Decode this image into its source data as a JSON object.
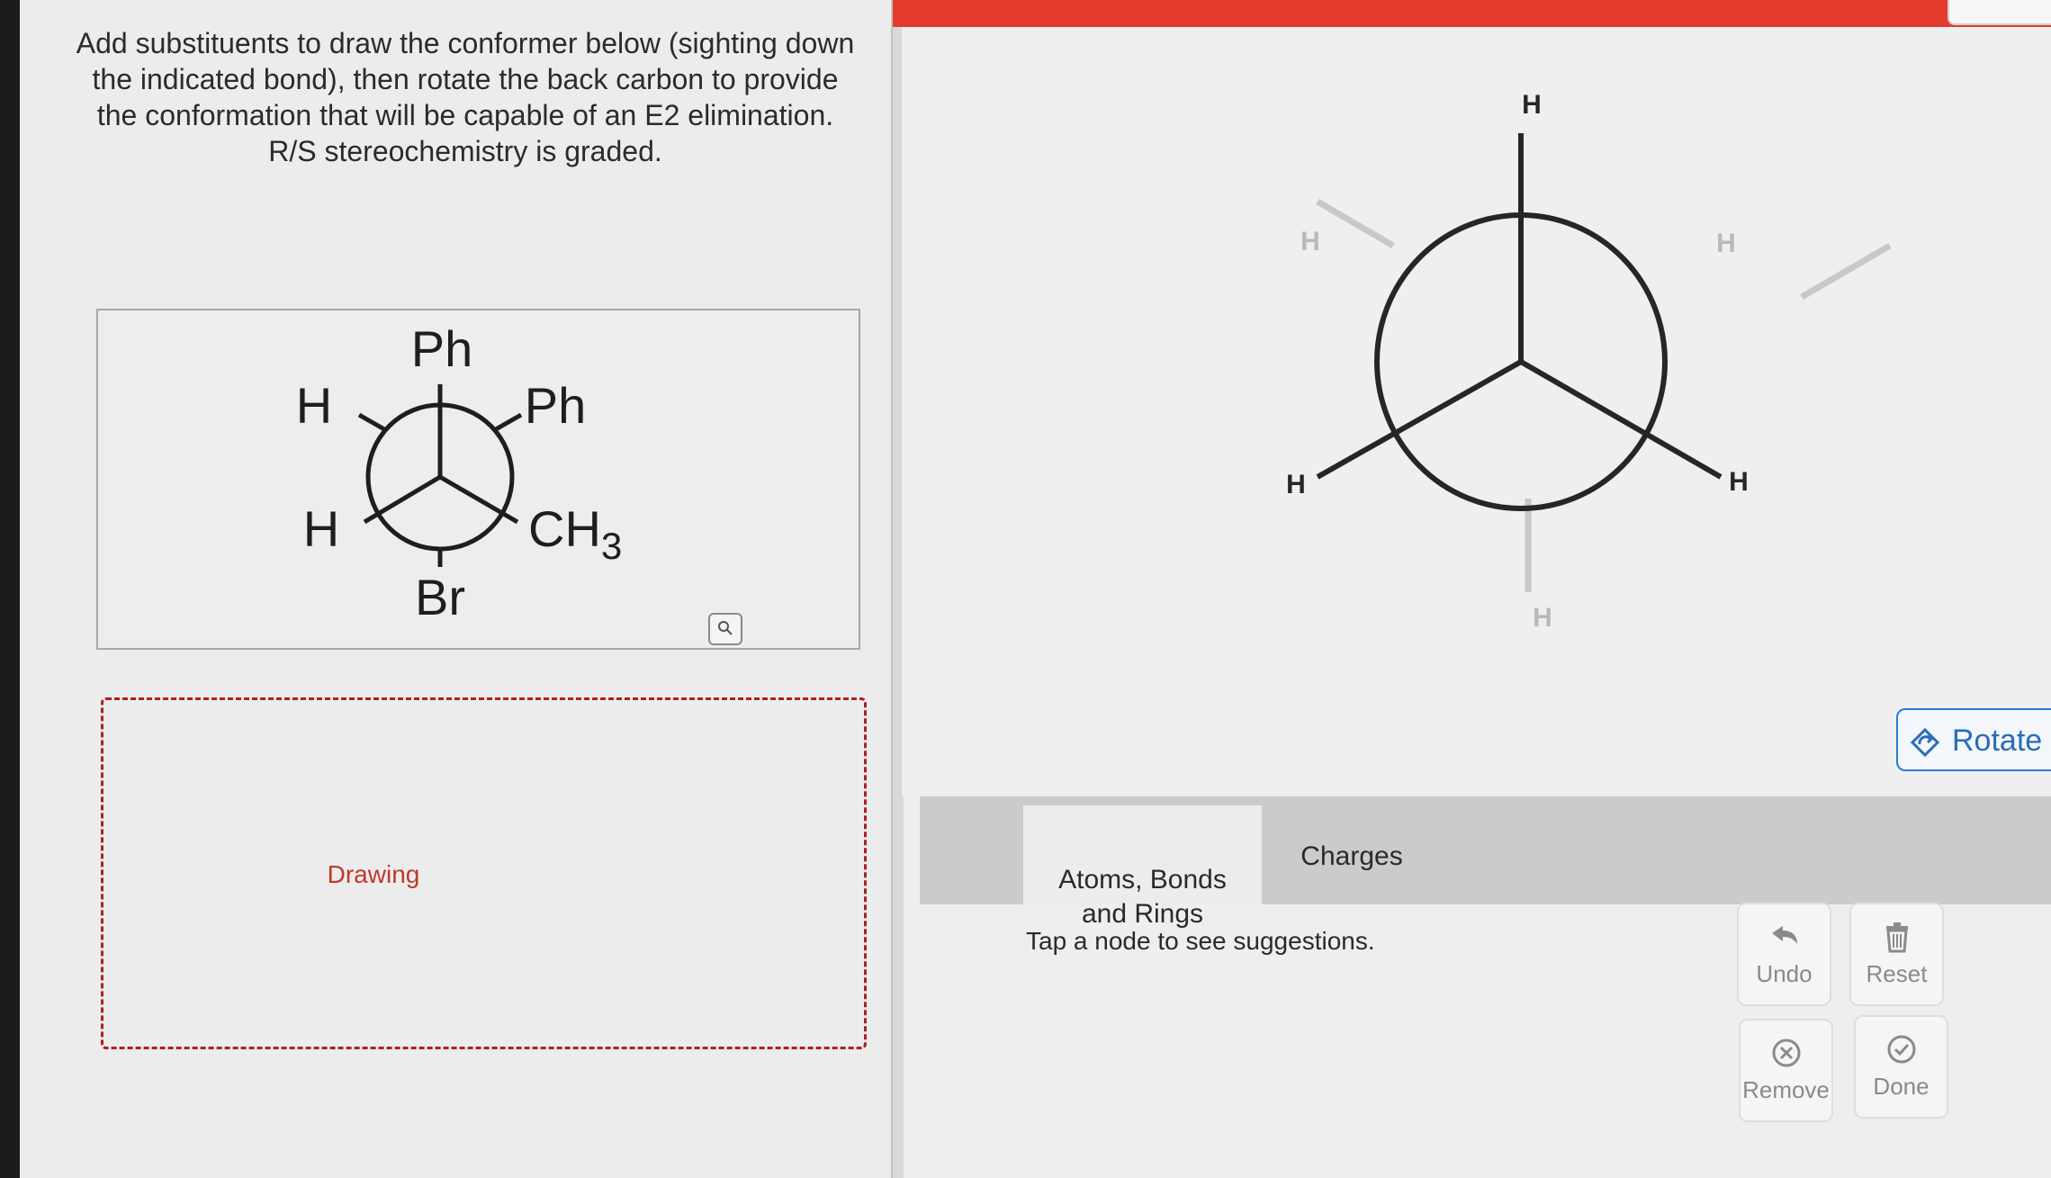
{
  "instructions": "Add substituents to draw the conformer below (sighting down the indicated bond), then rotate the back carbon to provide the conformation that will be capable of an E2 elimination. R/S stereochemistry is graded.",
  "reference_newman": {
    "front_top": "Ph",
    "front_left": "H",
    "front_right": "CH",
    "front_right_subscript": "3",
    "back_top_right": "Ph",
    "back_left": "H",
    "back_bottom": "Br"
  },
  "zoom_icon": "magnifier-icon",
  "drawing_label": "Drawing",
  "canvas_newman": {
    "front_top": "H",
    "front_left": "H",
    "front_right": "H",
    "back_upper_left": "H",
    "back_upper_right": "H",
    "back_bottom": "H"
  },
  "rotate_label": "Rotate",
  "tabs": [
    "Atoms, Bonds\nand Rings",
    "Charges"
  ],
  "hint": "Tap a node to see suggestions.",
  "buttons": {
    "undo": "Undo",
    "reset": "Reset",
    "remove": "Remove",
    "done": "Done"
  },
  "colors": {
    "accent_red": "#e23b2d",
    "link_blue": "#2a6cb8",
    "drawing_border": "#b11e1e"
  }
}
